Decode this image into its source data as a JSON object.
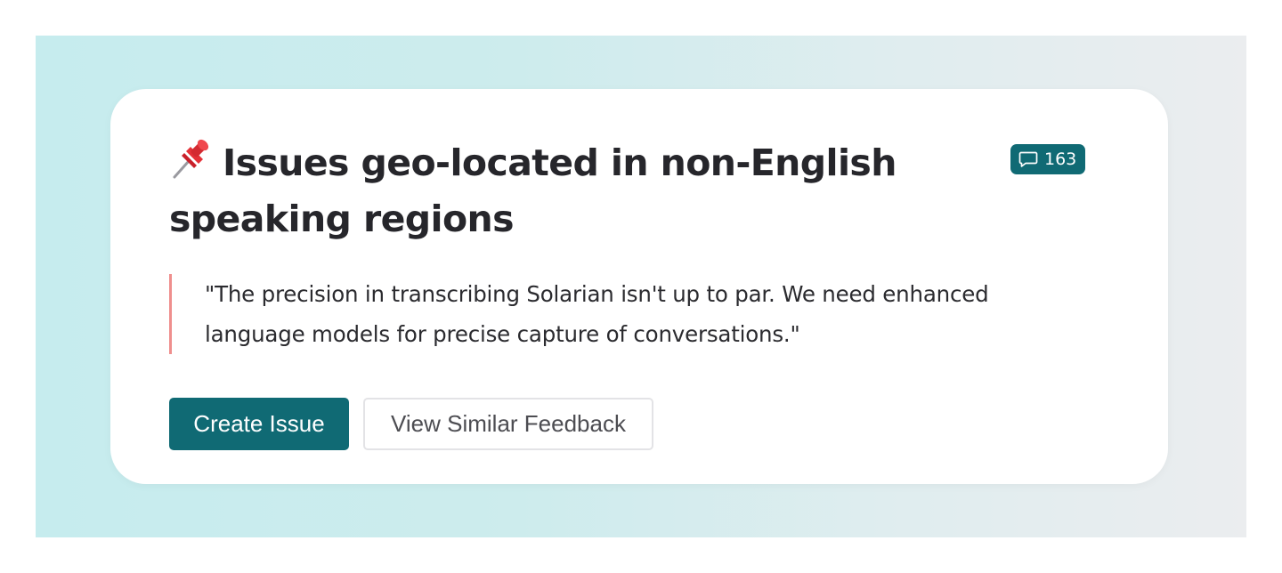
{
  "card": {
    "pin_icon": "pushpin-icon",
    "title": "Issues geo-located in non-English speaking regions",
    "comment_count": {
      "icon": "comment-icon",
      "value": "163"
    },
    "quote": "\"The precision in transcribing Solarian isn't up to par. We need enhanced language models for precise capture of conversations.\"",
    "actions": {
      "primary_label": "Create Issue",
      "secondary_label": "View Similar Feedback"
    }
  },
  "colors": {
    "accent": "#106a74",
    "quote_border": "#ef8f8d",
    "title_text": "#26262b",
    "background_gradient_start": "#c6ecee",
    "background_gradient_end": "#ebedef"
  }
}
